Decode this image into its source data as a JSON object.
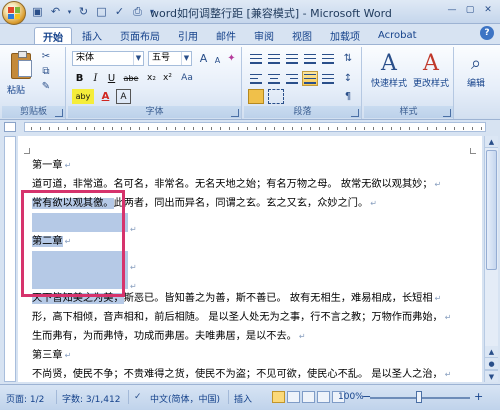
{
  "window": {
    "title": "word如何调整行距 [兼容模式] - Microsoft Word"
  },
  "tabs": [
    "开始",
    "插入",
    "页面布局",
    "引用",
    "邮件",
    "审阅",
    "视图",
    "加载项",
    "Acrobat"
  ],
  "ribbon": {
    "clipboard": {
      "paste_label": "粘贴",
      "group_label": "剪贴板"
    },
    "font": {
      "font_name": "宋体",
      "font_size": "五号",
      "bold": "B",
      "italic": "I",
      "underline": "U",
      "strike": "abe",
      "subscript": "x₂",
      "superscript": "x²",
      "aa": "Aa",
      "highlight": "aby",
      "font_color": "A",
      "char_border": "A",
      "group_label": "字体"
    },
    "paragraph": {
      "group_label": "段落"
    },
    "styles": {
      "quick_label": "快速样式",
      "change_label": "更改样式",
      "group_label": "样式"
    },
    "editing": {
      "label": "编辑"
    }
  },
  "document": {
    "lines": [
      {
        "text": "第一章",
        "selected": false
      },
      {
        "text": "道可道，非常道。名可名，非常名。无名天地之始；有名万物之母。 故常无欲以观其妙；",
        "selected": false
      },
      {
        "text": "常有欲以观其徼。",
        "rest": "此两者，同出而异名，同谓之玄。玄之又玄，众妙之门。",
        "selected": true
      },
      {
        "text": "",
        "selected": true
      },
      {
        "text": "第二章",
        "selected": true
      },
      {
        "text": "",
        "selected": true
      },
      {
        "text": "",
        "selected": true
      },
      {
        "text": "天下皆知美之为美，",
        "rest": "斯恶已。皆知善之为善，斯不善已。 故有无相生，难易相成，长短相",
        "selected": true
      },
      {
        "text": "形，高下相倾，音声相和，前后相随。 是以圣人处无为之事，行不言之教；万物作而弗始，",
        "selected": false
      },
      {
        "text": "生而弗有，为而弗恃，功成而弗居。夫唯弗居，是以不去。",
        "selected": false
      },
      {
        "text": "第三章",
        "selected": false
      },
      {
        "text": "不尚贤，使民不争；不贵难得之货，使民不为盗；不见可欲，使民心不乱。 是以圣人之治，",
        "selected": false
      },
      {
        "text": "虚其心，实其腹，弱其志，强其骨。常使民无知无欲。使夫智者不敢为也。为无为，则无不治。",
        "selected": false
      }
    ]
  },
  "status": {
    "page": "页面: 1/2",
    "words": "字数: 3/1,412",
    "lang": "中文(简体，中国)",
    "mode": "插入",
    "zoom": "100%"
  },
  "colors": {
    "accent": "#15428b",
    "selection": "#b5c9e6",
    "highlight_box": "#d6336c"
  }
}
